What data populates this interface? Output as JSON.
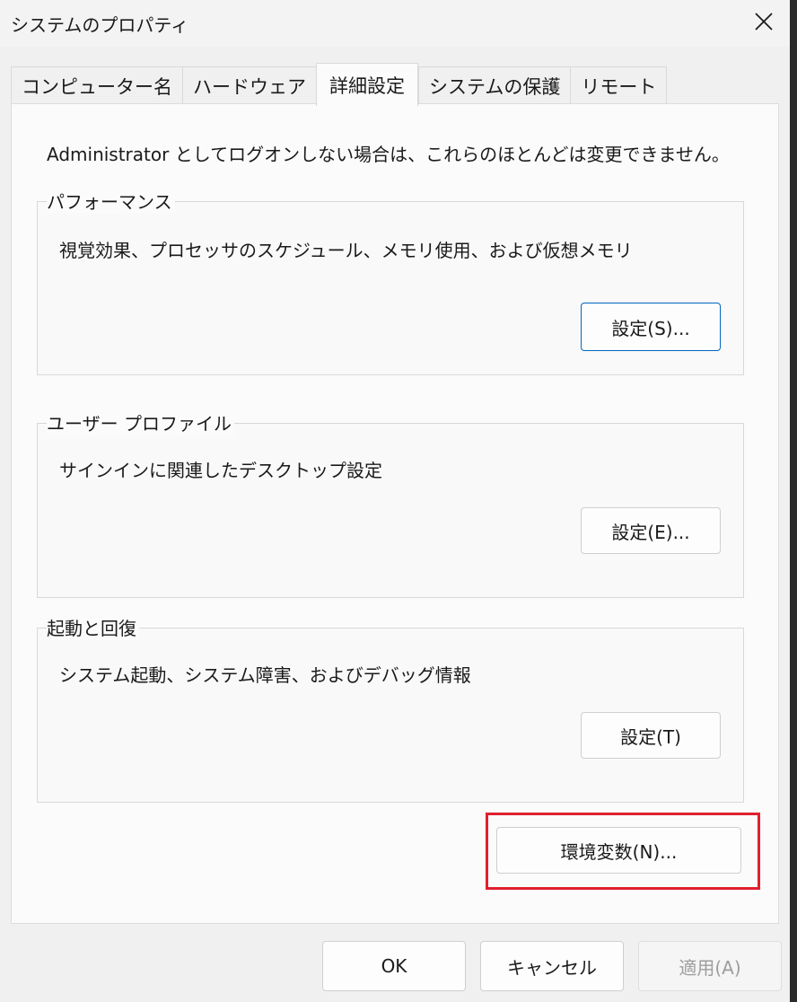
{
  "window": {
    "title": "システムのプロパティ",
    "close_icon": "close-icon"
  },
  "tabs": [
    {
      "label": "コンピューター名",
      "active": false
    },
    {
      "label": "ハードウェア",
      "active": false
    },
    {
      "label": "詳細設定",
      "active": true
    },
    {
      "label": "システムの保護",
      "active": false
    },
    {
      "label": "リモート",
      "active": false
    }
  ],
  "panel": {
    "admin_note": "Administrator としてログオンしない場合は、これらのほとんどは変更できません。",
    "performance": {
      "title": "パフォーマンス",
      "description": "視覚効果、プロセッサのスケジュール、メモリ使用、および仮想メモリ",
      "button": "設定(S)..."
    },
    "user_profile": {
      "title": "ユーザー プロファイル",
      "description": "サインインに関連したデスクトップ設定",
      "button": "設定(E)..."
    },
    "startup_recovery": {
      "title": "起動と回復",
      "description": "システム起動、システム障害、およびデバッグ情報",
      "button": "設定(T)"
    },
    "env_vars_button": "環境変数(N)..."
  },
  "footer": {
    "ok": "OK",
    "cancel": "キャンセル",
    "apply": "適用(A)"
  },
  "colors": {
    "highlight": "#e0202e",
    "focus_border": "#0067c0"
  }
}
